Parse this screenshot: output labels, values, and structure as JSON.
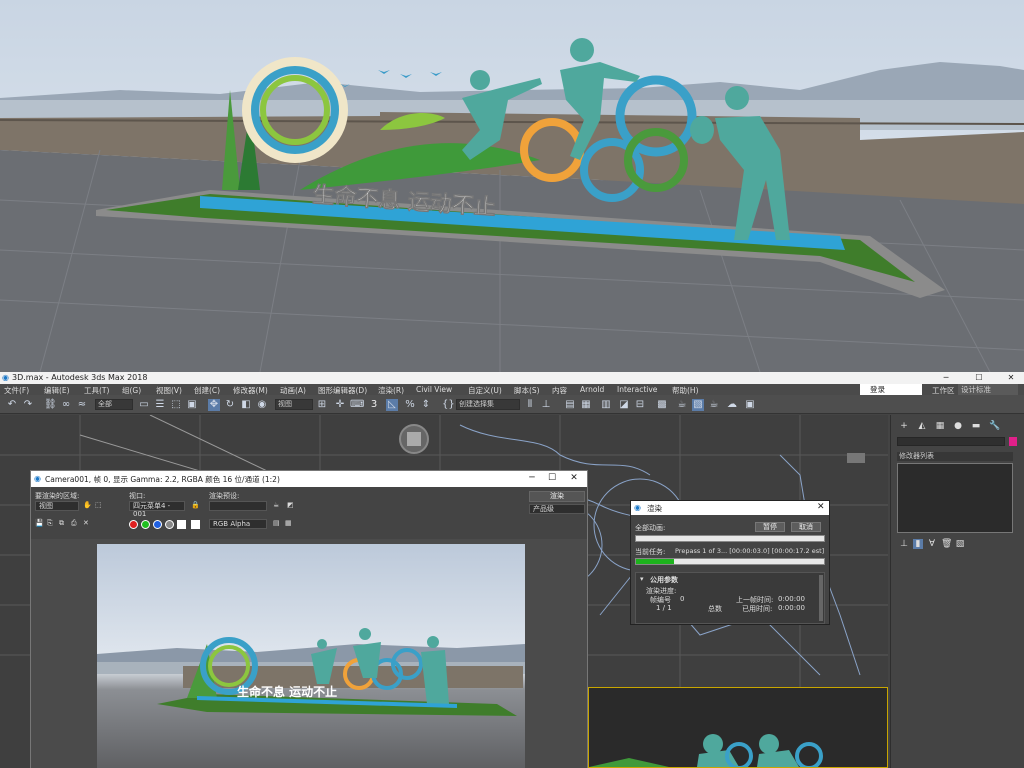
{
  "render": {
    "slogan": "生命不息 运动不止"
  },
  "app": {
    "title": "3D.max - Autodesk 3ds Max 2018",
    "minimize": "─",
    "maximize": "☐",
    "close": "✕"
  },
  "menu": {
    "items": [
      "文件(F)",
      "编辑(E)",
      "工具(T)",
      "组(G)",
      "视图(V)",
      "创建(C)",
      "修改器(M)",
      "动画(A)",
      "图形编辑器(D)",
      "渲染(R)",
      "Civil View",
      "自定义(U)",
      "脚本(S)",
      "内容",
      "Arnold",
      "Interactive",
      "帮助(H)"
    ],
    "login": "登录",
    "workspace_label": "工作区",
    "workspace_value": "设计标准"
  },
  "toolbar": {
    "filter": "全部",
    "view": "视图",
    "selection_set": "创建选择集",
    "snap_value": "3"
  },
  "cmdpanel": {
    "modifier_list": "修改器列表"
  },
  "framebuffer": {
    "title": "Camera001, 帧 0, 显示 Gamma: 2.2, RGBA 颜色 16 位/通道 (1:2)",
    "area_label": "要渲染的区域:",
    "area_value": "视图",
    "viewport_label": "视口:",
    "viewport_value": "四元菜单4 - 001",
    "preset_label": "渲染预设:",
    "render_button": "渲染",
    "quality_value": "产品级",
    "channel_value": "RGB Alpha"
  },
  "progress": {
    "title": "渲染",
    "all_frames_label": "全部动画:",
    "pause": "暂停",
    "cancel": "取消",
    "current_task_label": "当前任务:",
    "current_task_value": "Prepass 1 of 3... [00:00:03.0] [00:00:17.2 est]",
    "all_frames_progress": 0.0,
    "current_task_progress": 0.2,
    "section_title": "公用参数",
    "render_progress_label": "渲染进度:",
    "frame_label": "帧编号",
    "frame_value": "0",
    "frames_value": "1 / 1",
    "total_label": "总数",
    "last_time_label": "上一帧时间:",
    "last_time_value": "0:00:00",
    "elapsed_label": "已用时间:",
    "elapsed_value": "0:00:00"
  }
}
